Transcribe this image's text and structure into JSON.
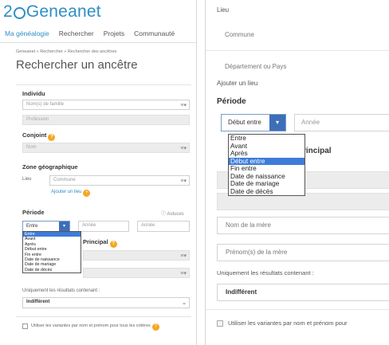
{
  "left": {
    "logo_text": "Geneanet",
    "logo_prefix": "2",
    "nav": [
      "Ma généalogie",
      "Rechercher",
      "Projets",
      "Communauté"
    ],
    "breadcrumb": "Geneanet » Rechercher » Rechercher des ancêtres",
    "title": "Rechercher un ancêtre",
    "individu": {
      "label": "Individu",
      "nom_placeholder": "Nom(s) de famille",
      "profession_placeholder": "Profession"
    },
    "conjoint": {
      "label": "Conjoint",
      "badge": "?",
      "nom_placeholder": "Nom"
    },
    "zone": {
      "label": "Zone géographique",
      "lieu_label": "Lieu",
      "commune_placeholder": "Commune",
      "add_place": "Ajouter un lieu"
    },
    "periode": {
      "label": "Période",
      "extra": "Astuces",
      "select_value": "Entre",
      "annee1": "Année",
      "annee2": "Année",
      "options": [
        "Entre",
        "Avant",
        "Après",
        "Début entre",
        "Fin entre",
        "Date de naissance",
        "Date de mariage",
        "Date de décès"
      ],
      "highlighted": "Entre"
    },
    "principal_label": "Principal",
    "resultats_label": "Uniquement les résultats contenant :",
    "resultats_value": "Indifférent",
    "variantes_label": "Utiliser les variantes par nom et prénom pour tous les critères"
  },
  "right": {
    "lieu_label": "Lieu",
    "commune_placeholder": "Commune",
    "departement_placeholder": "Département ou Pays",
    "add_place": "Ajouter un lieu",
    "periode_label": "Période",
    "select_value": "Début entre",
    "annee_placeholder": "Année",
    "options": [
      "Entre",
      "Avant",
      "Après",
      "Début entre",
      "Fin entre",
      "Date de naissance",
      "Date de mariage",
      "Date de décès"
    ],
    "highlighted": "Début entre",
    "principal_label": "rincipal",
    "mere_nom_placeholder": "Nom de la mère",
    "mere_prenom_placeholder": "Prénom(s) de la mère",
    "resultats_label": "Uniquement les résultats contenant :",
    "resultats_value": "Indifférent",
    "variantes_label": "Utiliser les variantes par nom et prénom pour"
  },
  "colors": {
    "brand": "#2e8ec4",
    "select_arrow": "#3d6fb8",
    "highlight": "#3d7cd8",
    "badge": "#f5a623"
  }
}
